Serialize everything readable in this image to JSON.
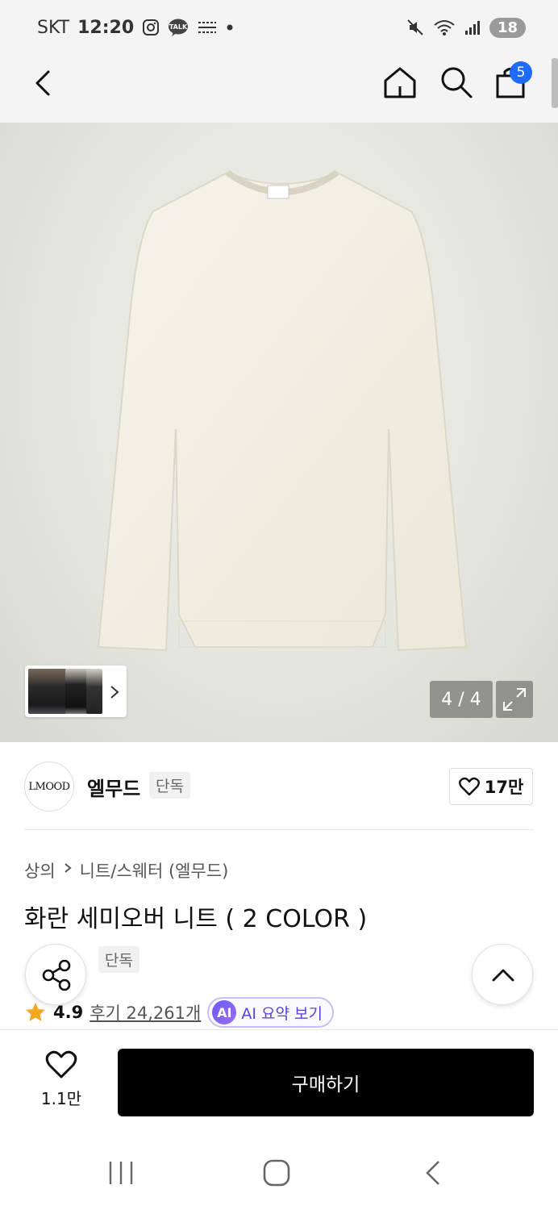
{
  "status_bar": {
    "carrier": "SKT",
    "time": "12:20",
    "talk_label": "TALK",
    "battery": "18",
    "icons": [
      "instagram-icon",
      "kakaotalk-icon",
      "notification-icon",
      "mute-icon",
      "wifi-icon",
      "signal-icon",
      "battery-icon"
    ]
  },
  "header": {
    "cart_count": "5",
    "icons": [
      "back-icon",
      "home-icon",
      "search-icon",
      "cart-icon"
    ]
  },
  "gallery": {
    "counter": "4 / 4",
    "current_index": 4,
    "total": 4,
    "product_color": "#f3f1e6",
    "background": "#e3e3dd"
  },
  "brand": {
    "logo_text": "LMOOD",
    "name": "엘무드",
    "badge": "단독",
    "likes": "17만"
  },
  "product": {
    "breadcrumb": [
      "상의",
      "니트/스웨터 (엘무드)"
    ],
    "title": "화란 세미오버 니트 ( 2 COLOR )",
    "tags": [
      "단독"
    ],
    "rating": "4.9",
    "review_text": "후기 24,261개",
    "ai_badge": "AI",
    "ai_summary": "AI 요약 보기",
    "star_color": "#f5a623"
  },
  "bottom_bar": {
    "wish_count": "1.1만",
    "buy_label": "구매하기"
  }
}
